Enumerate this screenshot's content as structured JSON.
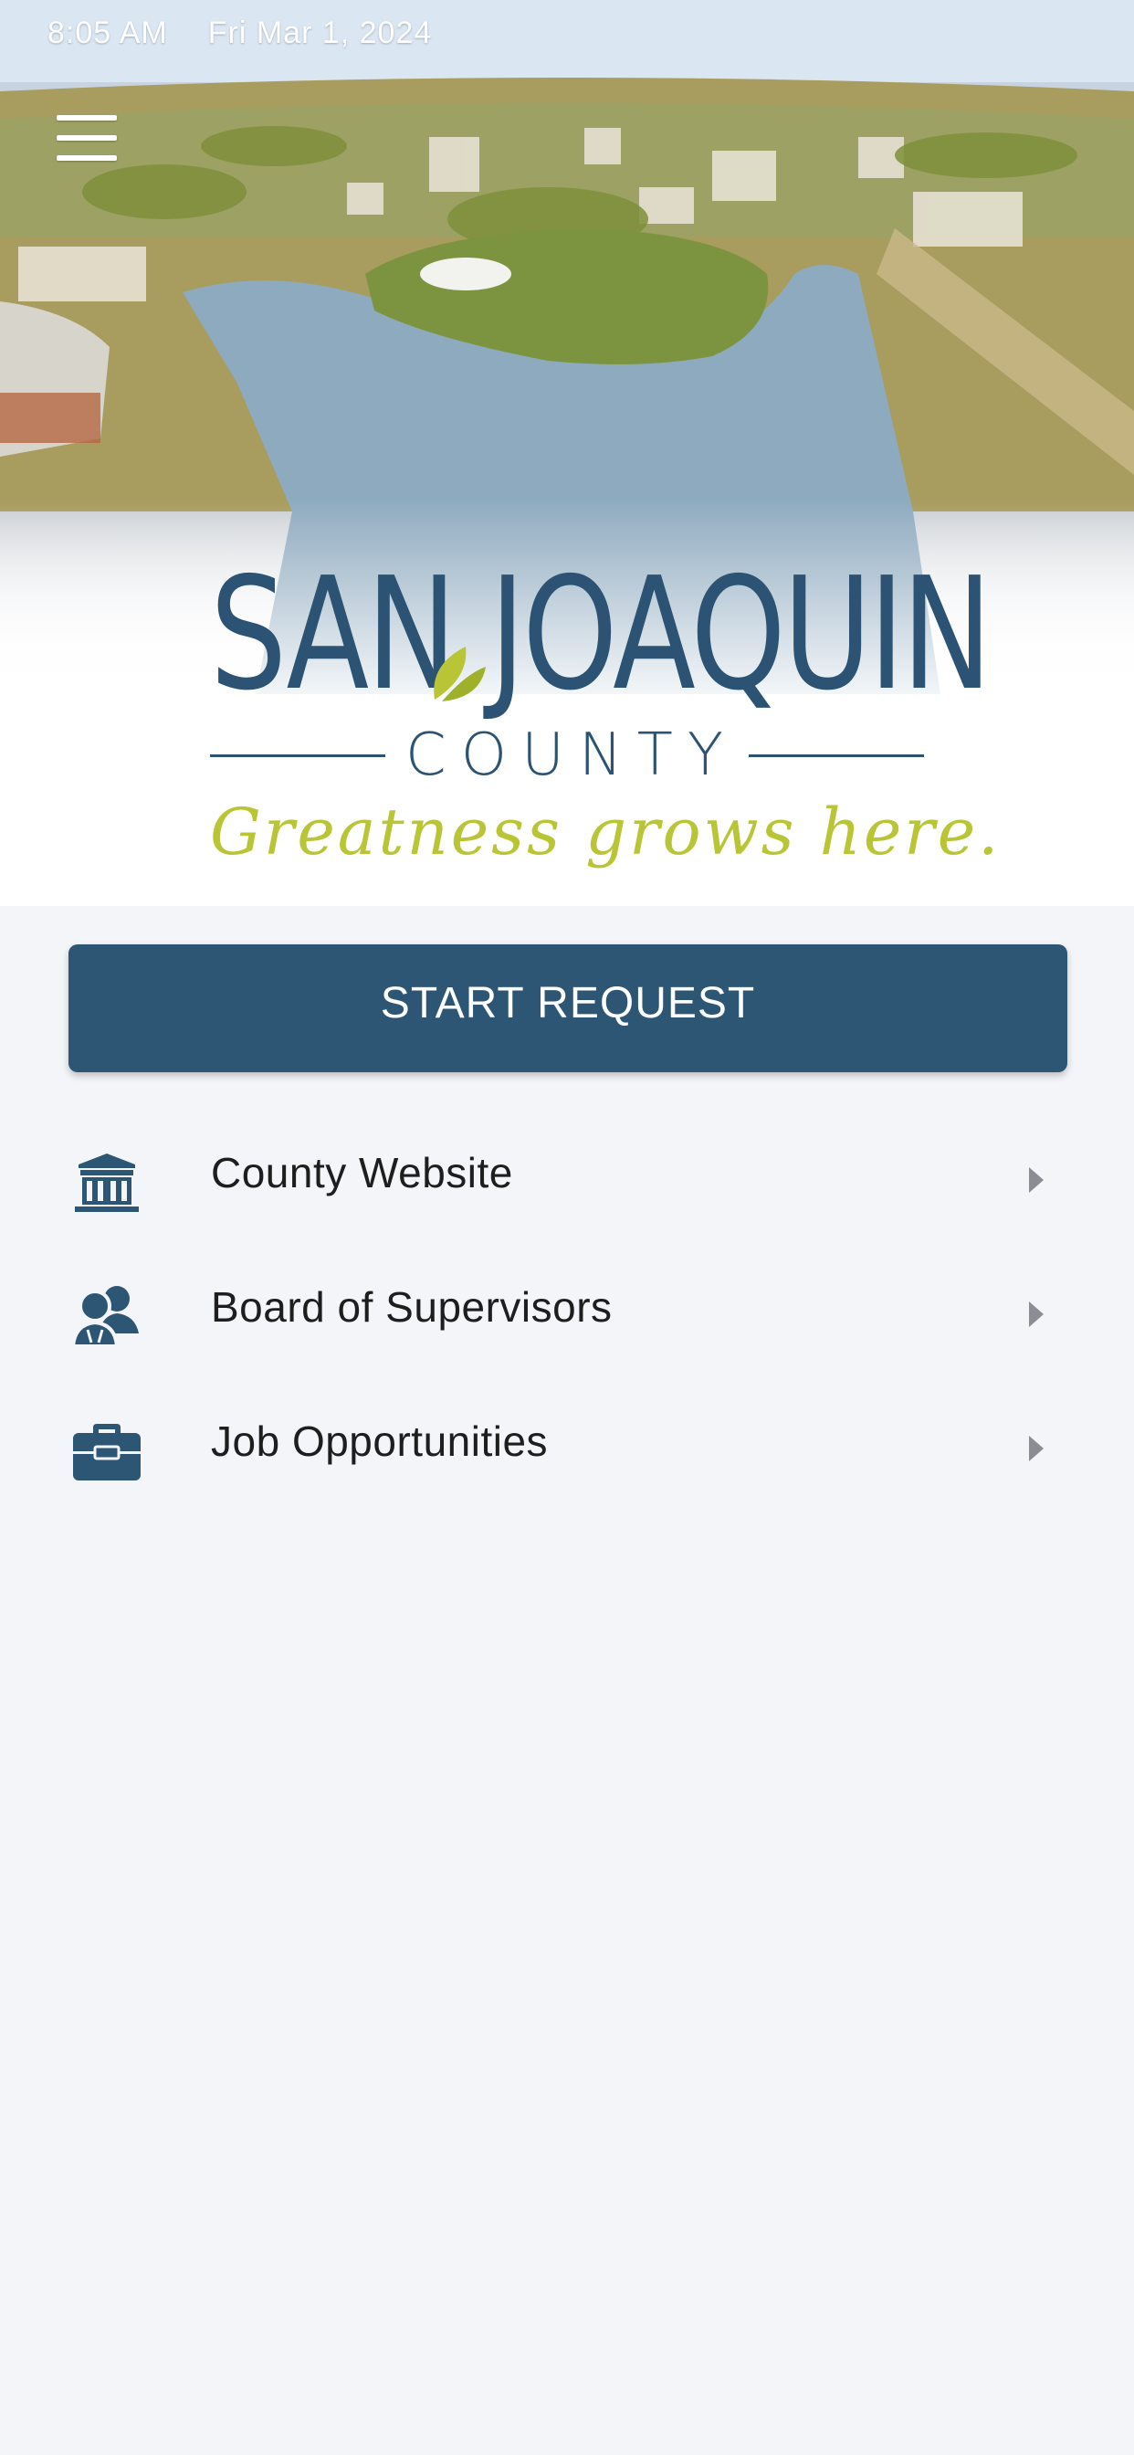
{
  "status_bar": {
    "time": "8:05 AM",
    "date": "Fri Mar 1, 2024"
  },
  "logo": {
    "title": "SAN JOAQUIN",
    "subtitle": "COUNTY",
    "tagline": "Greatness grows here."
  },
  "start_button": {
    "label": "START REQUEST"
  },
  "links": [
    {
      "label": "County Website",
      "icon": "building-icon"
    },
    {
      "label": "Board of Supervisors",
      "icon": "users-icon"
    },
    {
      "label": "Job Opportunities",
      "icon": "briefcase-icon"
    }
  ],
  "colors": {
    "brand_navy": "#2c5673",
    "brand_green": "#b9c535",
    "background": "#f4f5f8"
  }
}
